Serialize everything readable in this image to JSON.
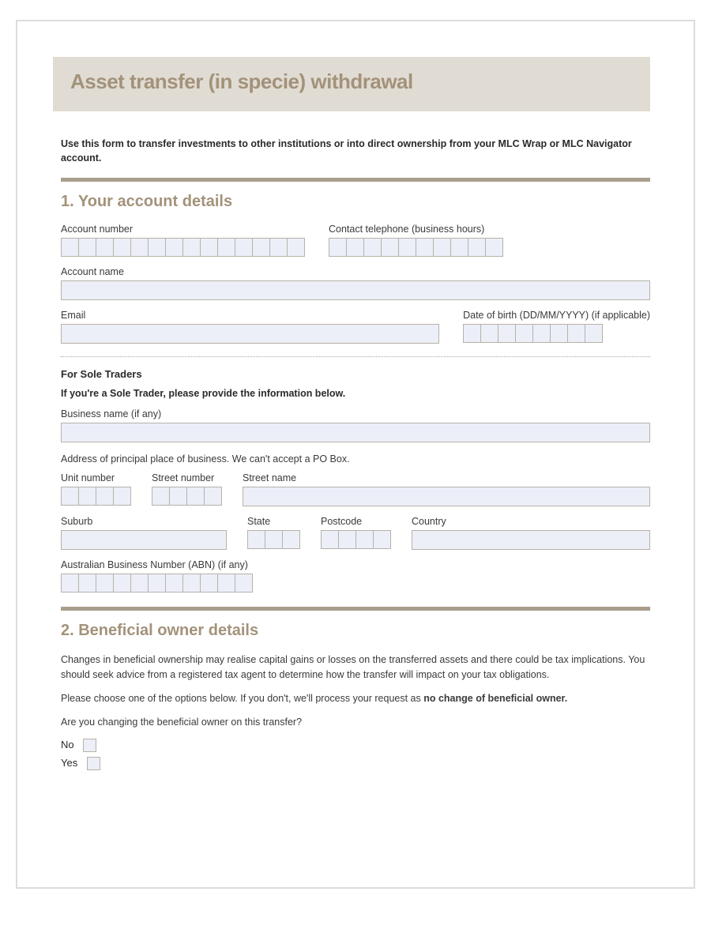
{
  "header": {
    "title": "Asset transfer (in specie) withdrawal"
  },
  "intro": "Use this form to transfer investments to other institutions or into direct ownership from your MLC Wrap or MLC Navigator account.",
  "section1": {
    "heading": "1. Your account details",
    "labels": {
      "account_number": "Account number",
      "contact_phone": "Contact telephone (business hours)",
      "account_name": "Account name",
      "email": "Email",
      "dob": "Date of birth (DD/MM/YYYY) (if applicable)"
    },
    "sole": {
      "heading": "For Sole Traders",
      "note": "If you're a Sole Trader, please provide the information below.",
      "business_name": "Business name (if any)",
      "address_note": "Address of principal place of business. We can't accept a PO Box.",
      "unit": "Unit number",
      "street_no": "Street number",
      "street_name": "Street name",
      "suburb": "Suburb",
      "state": "State",
      "postcode": "Postcode",
      "country": "Country",
      "abn": "Australian Business Number (ABN) (if any)"
    }
  },
  "section2": {
    "heading": "2. Beneficial owner details",
    "para": "Changes in beneficial ownership may realise capital gains or losses on the transferred assets and there could be tax implications. You should seek advice from a registered tax agent to determine how the transfer will impact on your tax obligations.",
    "choose_pre": "Please choose one of the options below. If you don't, we'll process your request as ",
    "choose_bold": "no change of beneficial owner.",
    "question": "Are you changing the beneficial owner on this transfer?",
    "no": "No",
    "yes": "Yes"
  }
}
